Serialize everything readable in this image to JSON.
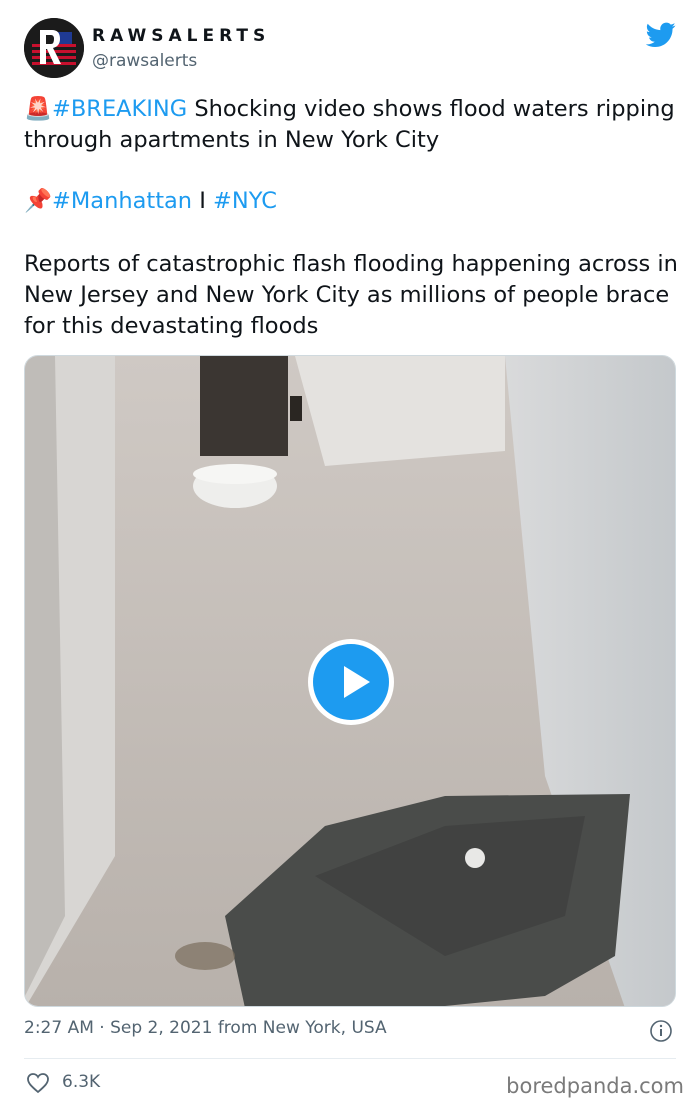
{
  "tweet": {
    "display_name": "RAWSALERTS",
    "handle": "@rawsalerts",
    "emoji_alert": "🚨",
    "emoji_pin": "📌",
    "hashtag_breaking": "#BREAKING",
    "line1": "Shocking video shows flood waters ripping through apartments in New York City",
    "hashtag_manhattan": "#Manhattan",
    "separator": "I",
    "hashtag_nyc": "#NYC",
    "body": "Reports of catastrophic flash flooding happening across in New Jersey and New York City as millions of people brace for this devastating floods",
    "timestamp": "2:27 AM · Sep 2, 2021 from New York, USA",
    "likes": "6.3K"
  },
  "media": {
    "type": "video",
    "icon": "play-icon"
  },
  "icons": {
    "logo": "twitter-bird-icon",
    "info": "info-icon",
    "like": "heart-icon"
  },
  "colors": {
    "link": "#1d9bf0",
    "secondary_text": "#536471",
    "primary_text": "#0f1419"
  },
  "watermark": "boredpanda.com"
}
